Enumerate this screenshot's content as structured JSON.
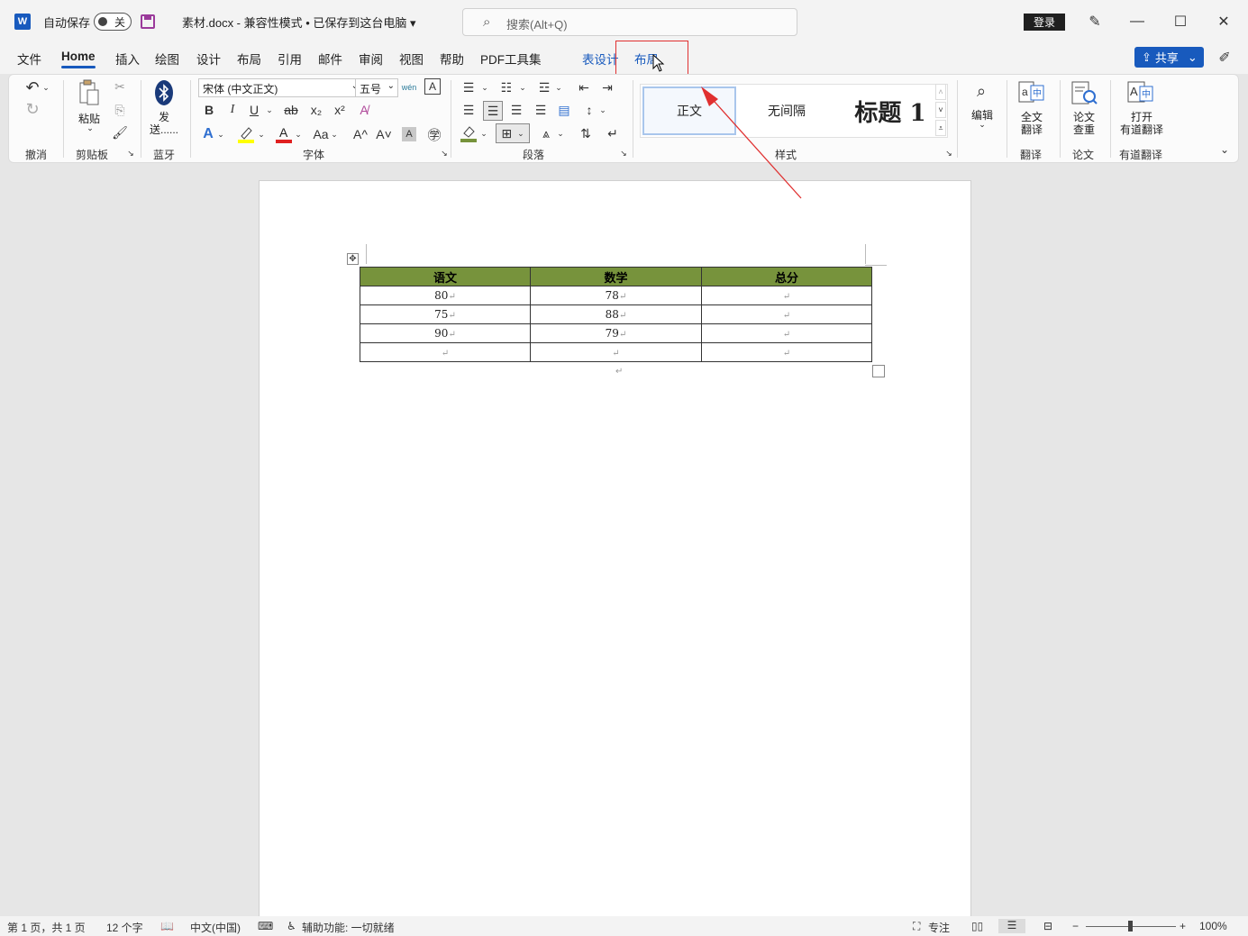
{
  "titlebar": {
    "app_icon": "W",
    "autosave_label": "自动保存",
    "autosave_state": "关",
    "doc_title": "素材.docx  -  兼容性模式 • 已保存到这台电脑 ▾",
    "search_placeholder": "搜索(Alt+Q)",
    "login_label": "登录"
  },
  "tabs": [
    "文件",
    "Home",
    "插入",
    "绘图",
    "设计",
    "布局",
    "引用",
    "邮件",
    "审阅",
    "视图",
    "帮助",
    "PDF工具集"
  ],
  "context_tabs": [
    "表设计",
    "布局"
  ],
  "share_label": "共享",
  "ribbon": {
    "undo_group": "撤消",
    "paste_label": "粘贴",
    "clipboard_group": "剪贴板",
    "bt_send_line1": "发",
    "bt_send_line2": "送......",
    "bluetooth_group": "蓝牙",
    "font_name": "宋体 (中文正文)",
    "font_size": "五号",
    "font_group": "字体",
    "paragraph_group": "段落",
    "styles": [
      "正文",
      "无间隔",
      "标题 1"
    ],
    "styles_group": "样式",
    "edit_label": "编辑",
    "translate_label_1": "全文",
    "translate_label_2": "翻译",
    "translate_group": "翻译",
    "paper_label_1": "论文",
    "paper_label_2": "查重",
    "paper_group": "论文",
    "youdao_label_1": "打开",
    "youdao_label_2": "有道翻译",
    "youdao_group": "有道翻译"
  },
  "table": {
    "headers": [
      "语文",
      "数学",
      "总分"
    ],
    "rows": [
      [
        "80",
        "78",
        ""
      ],
      [
        "75",
        "88",
        ""
      ],
      [
        "90",
        "79",
        ""
      ],
      [
        "",
        "",
        ""
      ]
    ],
    "header_color": "#77933c"
  },
  "statusbar": {
    "page": "第 1 页，共 1 页",
    "words": "12 个字",
    "language": "中文(中国)",
    "accessibility": "辅助功能: 一切就绪",
    "focus": "专注",
    "zoom": "100%"
  },
  "colors": {
    "accent": "#185abd",
    "annotation": "#e03030"
  }
}
